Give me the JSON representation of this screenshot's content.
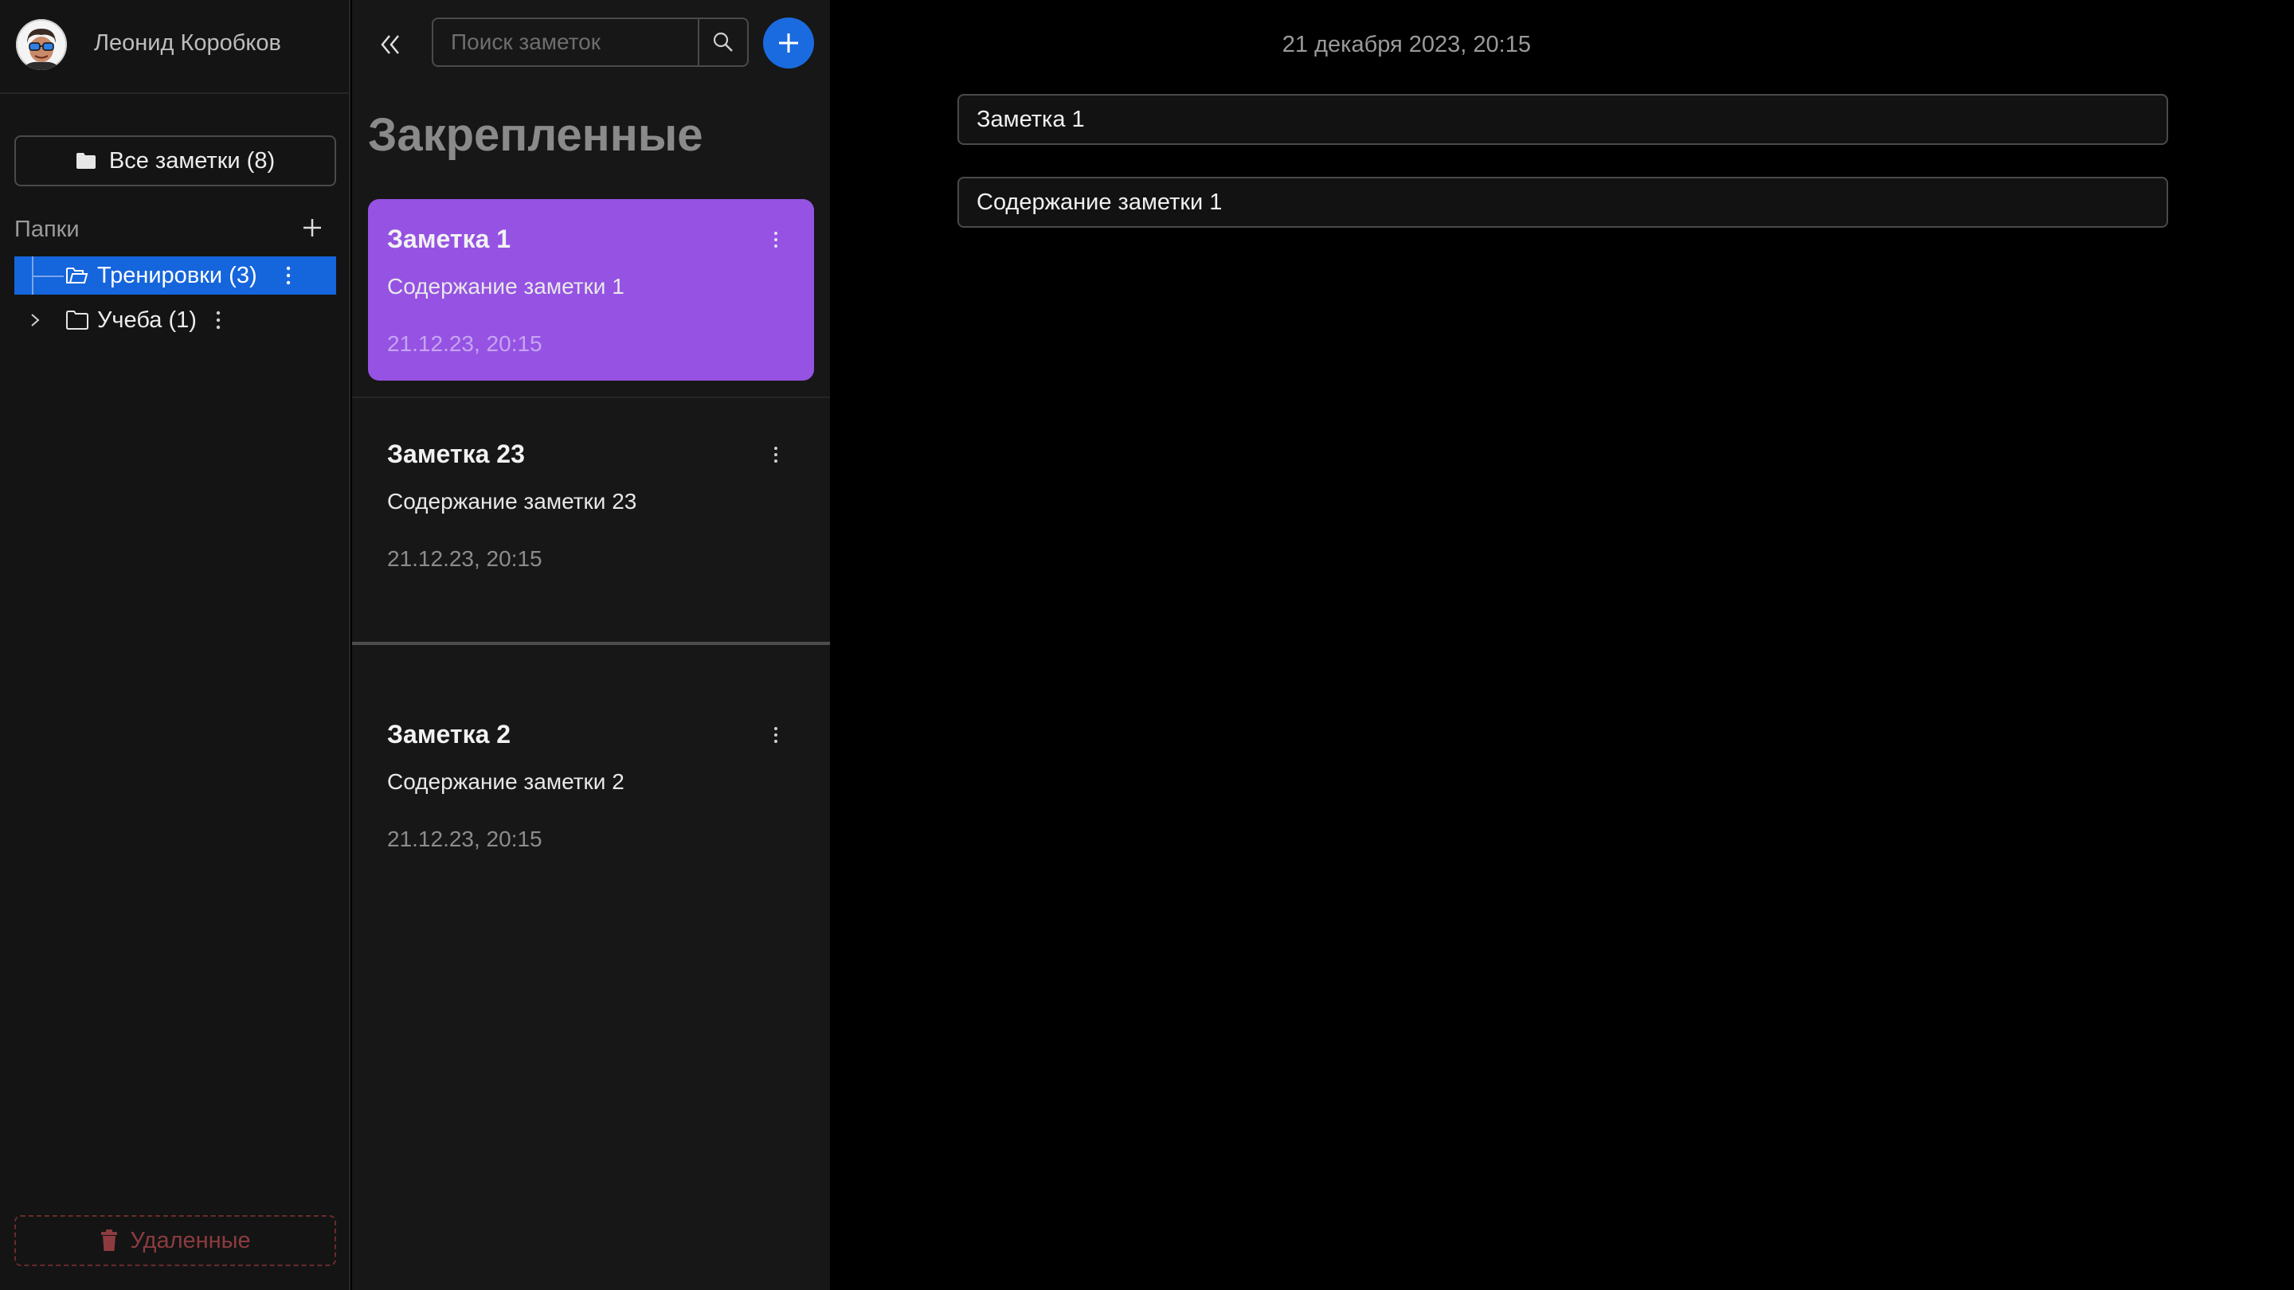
{
  "profile": {
    "name": "Леонид Коробков",
    "avatar_icon": "cartoon-avatar-icon"
  },
  "sidebar": {
    "all_notes_label": "Все заметки (8)",
    "folders_title": "Папки",
    "folders": [
      {
        "label": "Тренировки (3)",
        "active": true,
        "expanded": true,
        "icon": "folder-open-icon"
      },
      {
        "label": "Учеба (1)",
        "active": false,
        "expanded": false,
        "icon": "folder-icon"
      }
    ],
    "deleted_label": "Удаленные"
  },
  "notes_panel": {
    "search_placeholder": "Поиск заметок",
    "section_title": "Закрепленные",
    "notes": [
      {
        "title": "Заметка 1",
        "content": "Содержание заметки 1",
        "date": "21.12.23, 20:15",
        "selected": true
      },
      {
        "title": "Заметка 23",
        "content": "Содержание заметки 23",
        "date": "21.12.23, 20:15",
        "selected": false
      },
      {
        "title": "Заметка 2",
        "content": "Содержание заметки 2",
        "date": "21.12.23, 20:15",
        "selected": false
      }
    ]
  },
  "editor": {
    "date": "21 декабря 2023, 20:15",
    "title_value": "Заметка 1",
    "content_value": "Содержание заметки 1"
  },
  "colors": {
    "accent_blue": "#1a6be0",
    "selected_note": "#9552e3",
    "active_folder": "#1565dc",
    "deleted_red": "#8d3b3f"
  }
}
